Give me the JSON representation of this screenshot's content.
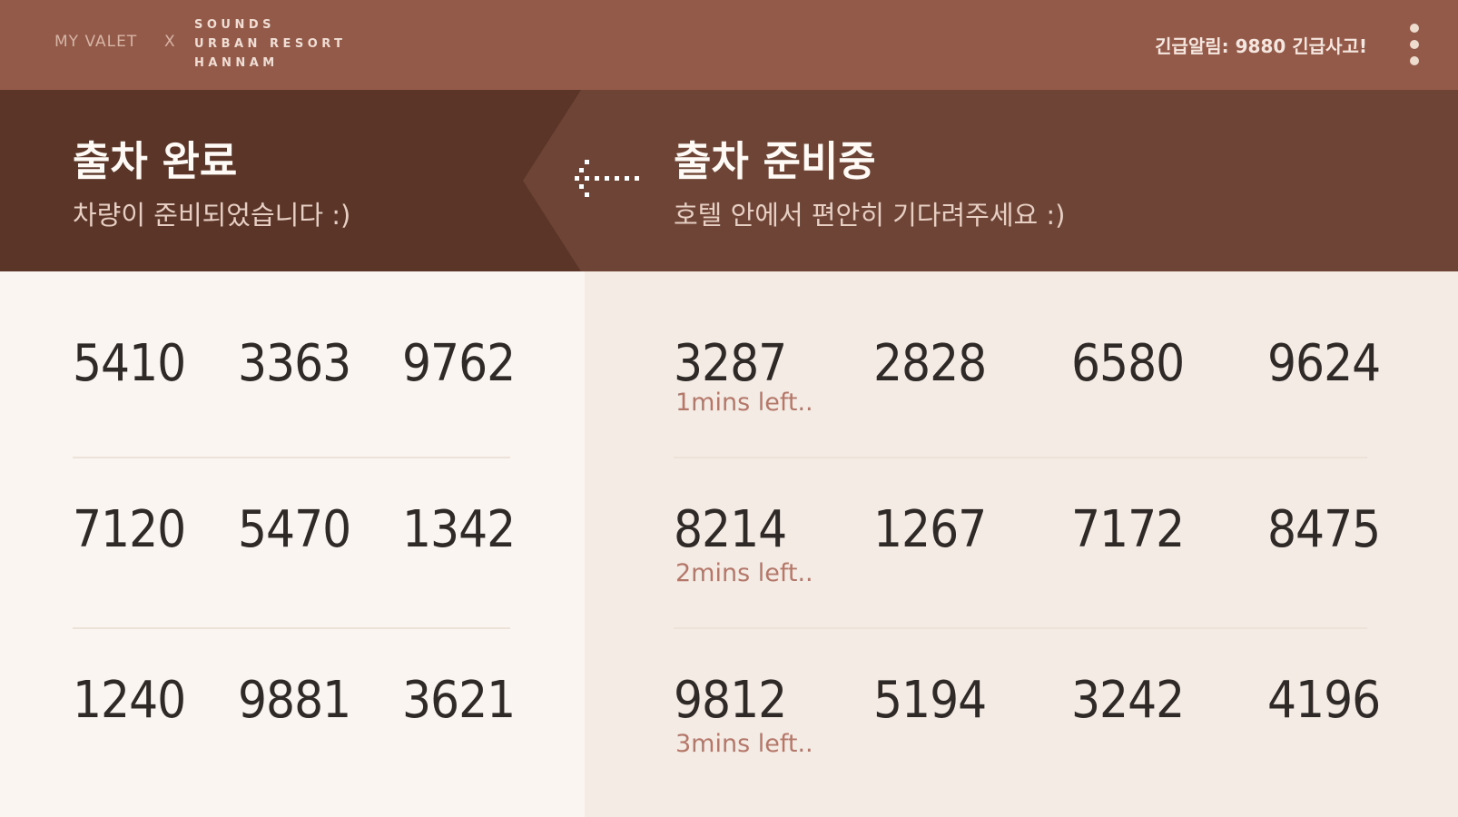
{
  "topbar": {
    "brand_left": "MY VALET",
    "brand_sep": "X",
    "brand_right": [
      "SOUNDS",
      "URBAN RESORT",
      "HANNAM"
    ],
    "alert": "긴급알림: 9880 긴급사고!",
    "menu_icon": "more-vertical-icon"
  },
  "ready": {
    "title": "출차 완료",
    "subtitle": "차량이 준비되었습니다 :)",
    "rows": [
      [
        "5410",
        "3363",
        "9762"
      ],
      [
        "7120",
        "5470",
        "1342"
      ],
      [
        "1240",
        "9881",
        "3621"
      ]
    ]
  },
  "preparing": {
    "title": "출차 준비중",
    "subtitle": "호텔 안에서 편안히 기다려주세요 :)",
    "rows": [
      {
        "numbers": [
          "3287",
          "2828",
          "6580",
          "9624"
        ],
        "eta": "1mins left.."
      },
      {
        "numbers": [
          "8214",
          "1267",
          "7172",
          "8475"
        ],
        "eta": "2mins left.."
      },
      {
        "numbers": [
          "9812",
          "5194",
          "3242",
          "4196"
        ],
        "eta": "3mins left.."
      }
    ]
  },
  "arrow_icon": "dotted-left-arrow-icon",
  "colors": {
    "topbar": "#935a4a",
    "header_left": "#5b3628",
    "header_right": "#6d4435",
    "eta_text": "#b4786a"
  }
}
